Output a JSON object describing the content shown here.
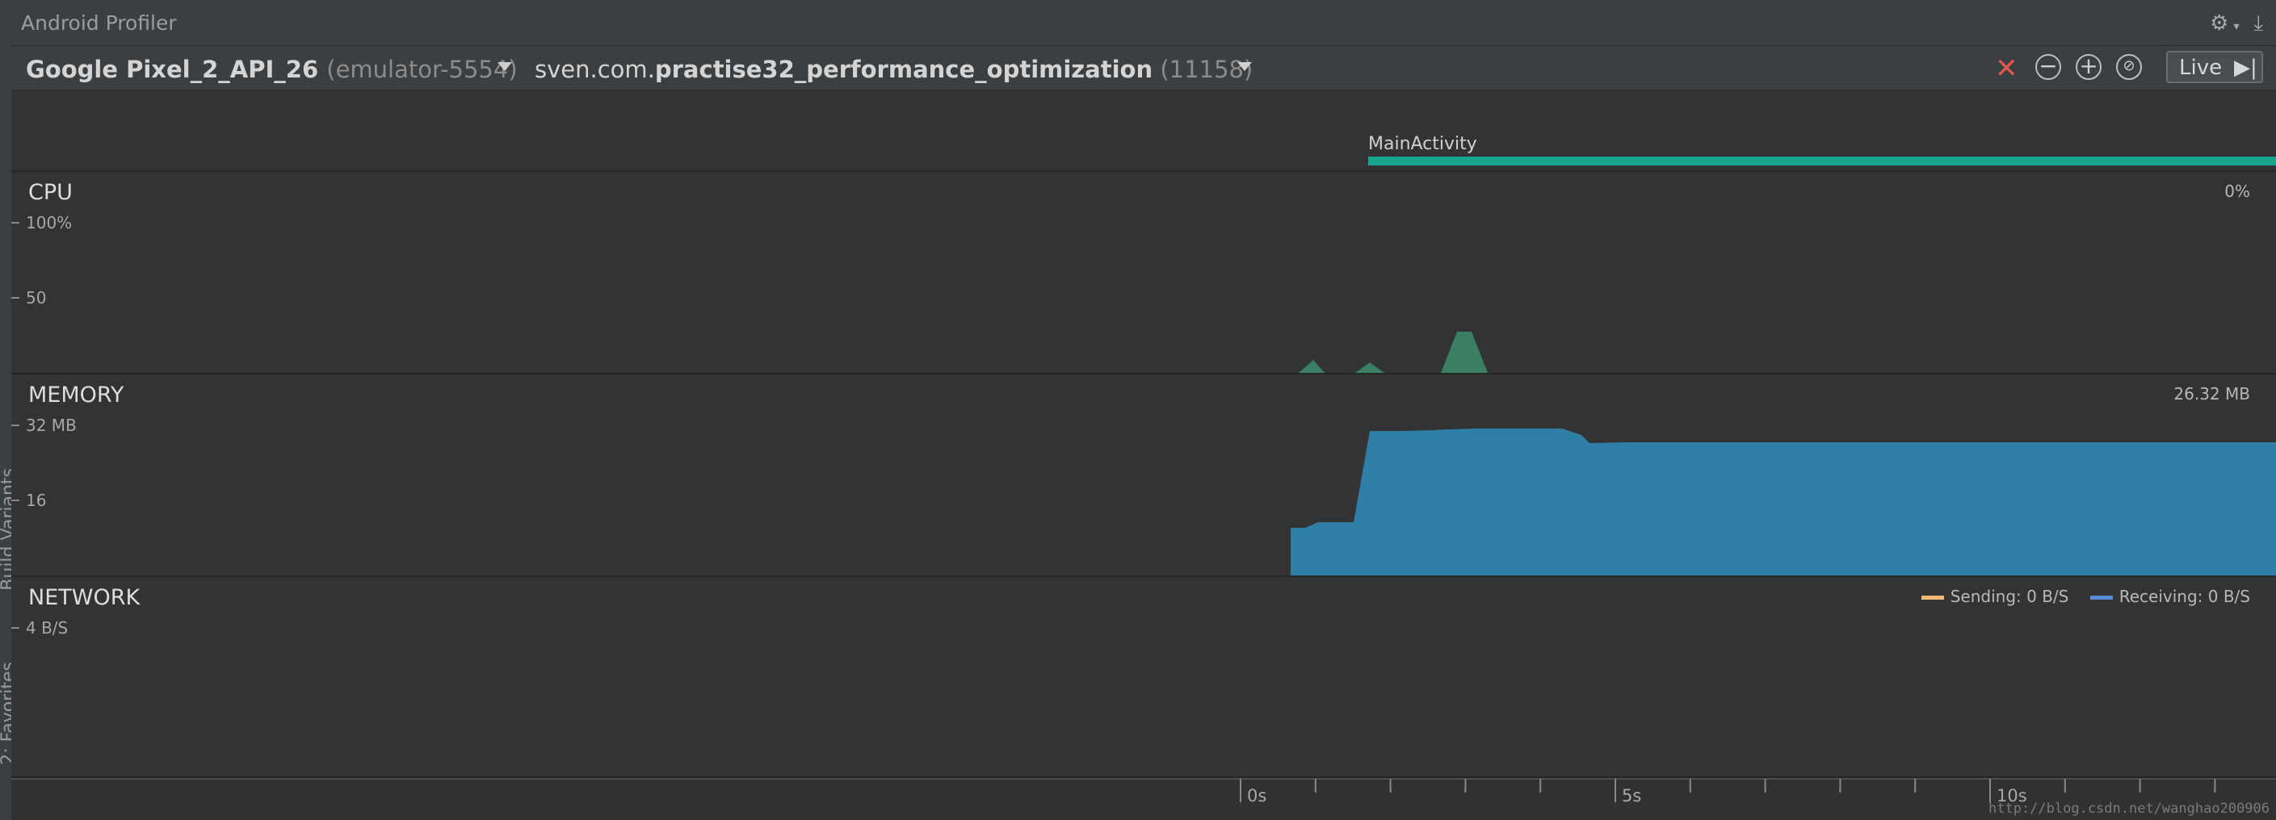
{
  "window": {
    "title": "Android Profiler",
    "gutter_labels": [
      "Build Variants",
      "2: Favorites"
    ]
  },
  "toolbar": {
    "device_name": "Google Pixel_2_API_26",
    "device_detail": "(emulator-5554)",
    "process_prefix": "sven.com.",
    "process_name": "practise32_performance_optimization",
    "process_pid": "(11158)",
    "live_label": "Live"
  },
  "activity": {
    "name": "MainActivity",
    "bar_color": "#1aa58f"
  },
  "cpu": {
    "title": "CPU",
    "current_value": "0%",
    "axis_labels": [
      "100%",
      "50"
    ],
    "color": "#3a7f64"
  },
  "memory": {
    "title": "MEMORY",
    "current_value": "26.32 MB",
    "axis_labels": [
      "32 MB",
      "16"
    ],
    "color": "#2e7ea6"
  },
  "network": {
    "title": "NETWORK",
    "axis_labels": [
      "4 B/S"
    ],
    "sending_label": "Sending: 0 B/S",
    "receiving_label": "Receiving: 0 B/S",
    "sending_color": "#f5b97a",
    "receiving_color": "#5b8bd6"
  },
  "timeline": {
    "labels": [
      "0s",
      "5s",
      "10s"
    ]
  },
  "watermark": "http://blog.csdn.net/wanghao200906"
}
